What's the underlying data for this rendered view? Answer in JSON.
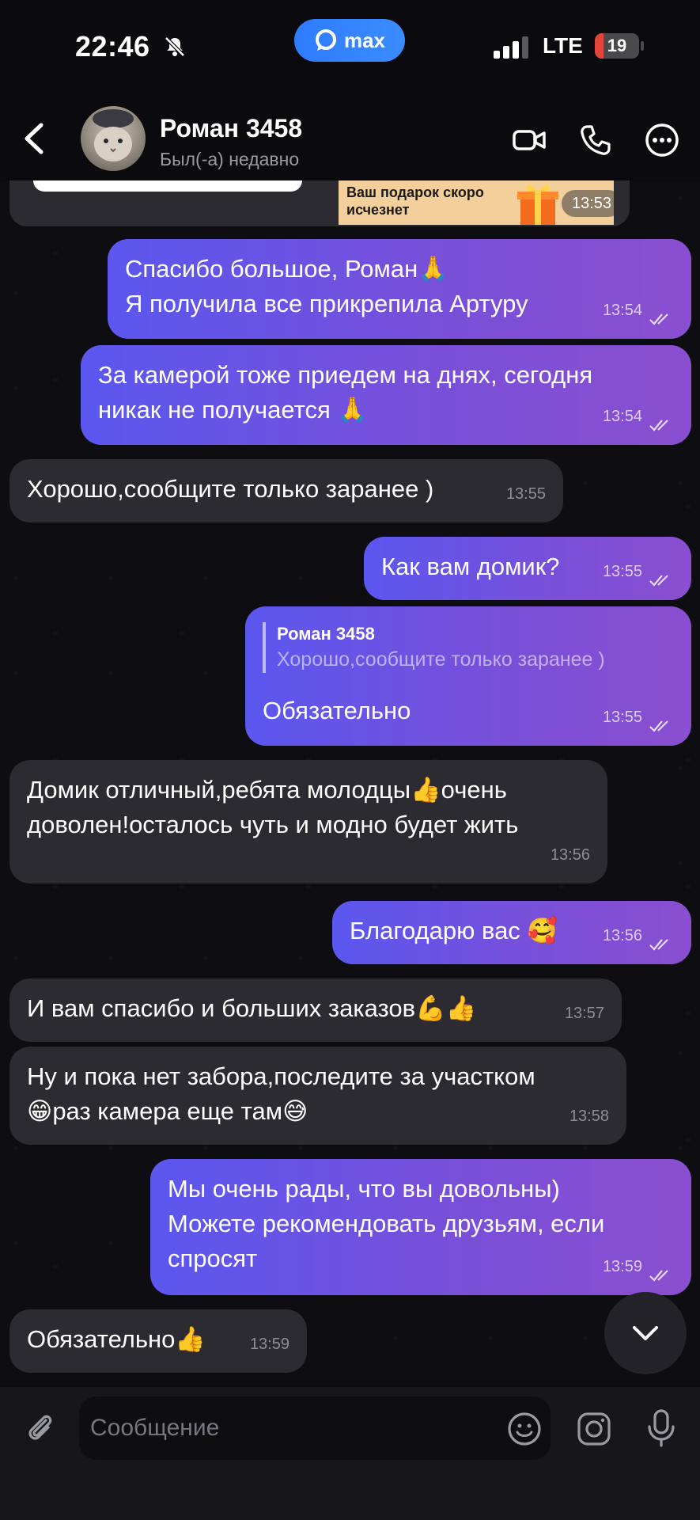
{
  "status_bar": {
    "time": "22:46",
    "app_pill_label": "max",
    "network": "LTE",
    "battery_percent": 19,
    "battery_label": "19"
  },
  "header": {
    "contact_name": "Роман 3458",
    "contact_status": "Был(-а) недавно",
    "icons": [
      "back-icon",
      "video-call-icon",
      "phone-icon",
      "more-icon"
    ]
  },
  "top_message": {
    "promo_text": "Ваш подарок скоро исчезнет",
    "time": "13:53"
  },
  "messages": [
    {
      "direction": "out",
      "text": "Спасибо большое, Роман🙏\nЯ получила все прикрепила Артуру",
      "time": "13:54",
      "read": true
    },
    {
      "direction": "out",
      "text": "За камерой тоже приедем на днях, сегодня\nникак не получается 🙏",
      "time": "13:54",
      "read": true
    },
    {
      "direction": "in",
      "text": "Хорошо,сообщите только заранее )",
      "time": "13:55"
    },
    {
      "direction": "out",
      "text": "Как вам домик?",
      "time": "13:55",
      "read": true
    },
    {
      "direction": "out",
      "reply_author": "Роман 3458",
      "reply_text": "Хорошо,сообщите только заранее )",
      "text": "Обязательно",
      "time": "13:55",
      "read": true
    },
    {
      "direction": "in",
      "text": "Домик отличный,ребята молодцы👍очень\nдоволен!осталось чуть и модно будет жить",
      "time": "13:56"
    },
    {
      "direction": "out",
      "text": "Благодарю вас 🥰",
      "time": "13:56",
      "read": true
    },
    {
      "direction": "in",
      "text": "И вам спасибо и больших заказов💪👍",
      "time": "13:57"
    },
    {
      "direction": "in",
      "text": "Ну и пока нет забора,последите за участком\n😁раз камера еще там😅",
      "time": "13:58"
    },
    {
      "direction": "out",
      "text": "Мы очень рады, что вы довольны)\nМожете рекомендовать друзьям, если\nспросят",
      "time": "13:59",
      "read": true
    },
    {
      "direction": "in",
      "text": "Обязательно👍",
      "time": "13:59"
    }
  ],
  "composer": {
    "placeholder": "Сообщение",
    "icons": [
      "attach-icon",
      "emoji-icon",
      "sticker-icon",
      "mic-icon"
    ]
  },
  "colors": {
    "outgoing_start": "#5b57ef",
    "outgoing_end": "#8a4fd0",
    "incoming": "#2b2b31",
    "background": "#0d0d12",
    "app_pill": "#2f7bff",
    "battery": "#e5443a"
  }
}
